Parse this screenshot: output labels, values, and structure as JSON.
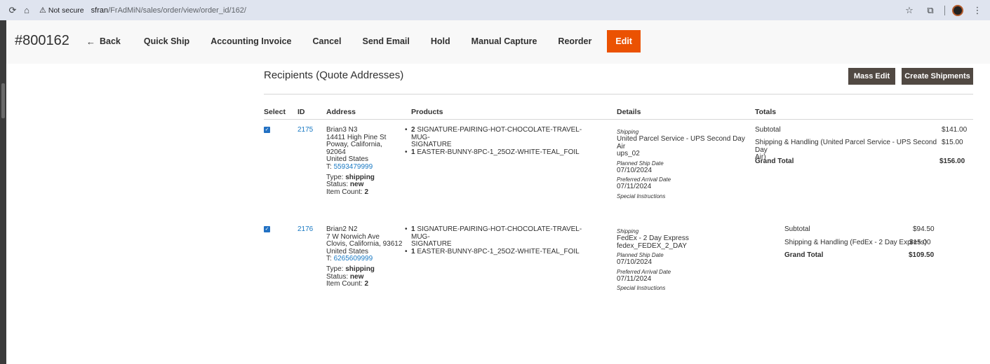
{
  "browser": {
    "not_secure": "Not secure",
    "url_host": "sfran",
    "url_path": "/FrAdMiN/sales/order/view/order_id/162/"
  },
  "header": {
    "order_number": "#800162",
    "actions": {
      "back": "Back",
      "quick_ship": "Quick Ship",
      "accounting_invoice": "Accounting Invoice",
      "cancel": "Cancel",
      "send_email": "Send Email",
      "hold": "Hold",
      "manual_capture": "Manual Capture",
      "reorder": "Reorder",
      "edit": "Edit"
    },
    "accent_color": "#eb5202"
  },
  "recipients": {
    "title": "Recipients (Quote Addresses)",
    "mass_edit": "Mass Edit",
    "create_shipments": "Create Shipments",
    "columns": {
      "select": "Select",
      "id": "ID",
      "address": "Address",
      "products": "Products",
      "details": "Details",
      "totals": "Totals"
    },
    "rows": [
      {
        "selected": true,
        "id": "2175",
        "address": {
          "name": "Brian3 N3",
          "street": "14411 High Pine St",
          "city_line_1": "Poway, California,",
          "city_line_2": "92064",
          "country": "United States",
          "phone_prefix": "T: ",
          "phone": "5593479999",
          "type_label": "Type: ",
          "type": "shipping",
          "status_label": "Status: ",
          "status": "new",
          "count_label": "Item Count: ",
          "count": "2"
        },
        "products": [
          {
            "qty": "2",
            "line_1": "SIGNATURE-PAIRING-HOT-CHOCOLATE-TRAVEL-MUG-",
            "line_2": "SIGNATURE"
          },
          {
            "qty": "1",
            "line_1": "EASTER-BUNNY-8PC-1_25OZ-WHITE-TEAL_FOIL",
            "line_2": ""
          }
        ],
        "details": {
          "shipping_label": "Shipping",
          "carrier_line_1": "United Parcel Service - UPS Second Day",
          "carrier_line_2": "Air",
          "method_code": "ups_02",
          "planned_label": "Planned Ship Date",
          "planned_date": "07/10/2024",
          "arrival_label": "Preferred Arrival Date",
          "arrival_date": "07/11/2024",
          "instructions_label": "Special Instructions"
        },
        "totals": {
          "subtotal_label": "Subtotal",
          "subtotal": "$141.00",
          "shipping_label_line_1": "Shipping & Handling (United Parcel Service - UPS Second Day",
          "shipping_label_line_2": "Air)",
          "shipping": "$15.00",
          "grand_label": "Grand Total",
          "grand": "$156.00"
        }
      },
      {
        "selected": true,
        "id": "2176",
        "address": {
          "name": "Brian2 N2",
          "street": "7 W Norwich Ave",
          "city_line_1": "Clovis, California, 93612",
          "country": "United States",
          "phone_prefix": "T: ",
          "phone": "6265609999",
          "type_label": "Type: ",
          "type": "shipping",
          "status_label": "Status: ",
          "status": "new",
          "count_label": "Item Count: ",
          "count": "2"
        },
        "products": [
          {
            "qty": "1",
            "line_1": "SIGNATURE-PAIRING-HOT-CHOCOLATE-TRAVEL-MUG-",
            "line_2": "SIGNATURE"
          },
          {
            "qty": "1",
            "line_1": "EASTER-BUNNY-8PC-1_25OZ-WHITE-TEAL_FOIL",
            "line_2": ""
          }
        ],
        "details": {
          "shipping_label": "Shipping",
          "carrier_line_1": "FedEx - 2 Day Express",
          "method_code": "fedex_FEDEX_2_DAY",
          "planned_label": "Planned Ship Date",
          "planned_date": "07/10/2024",
          "arrival_label": "Preferred Arrival Date",
          "arrival_date": "07/11/2024",
          "instructions_label": "Special Instructions"
        },
        "totals": {
          "subtotal_label": "Subtotal",
          "subtotal": "$94.50",
          "shipping_label": "Shipping & Handling (FedEx - 2 Day Express)",
          "shipping": "$15.00",
          "grand_label": "Grand Total",
          "grand": "$109.50"
        }
      }
    ]
  }
}
